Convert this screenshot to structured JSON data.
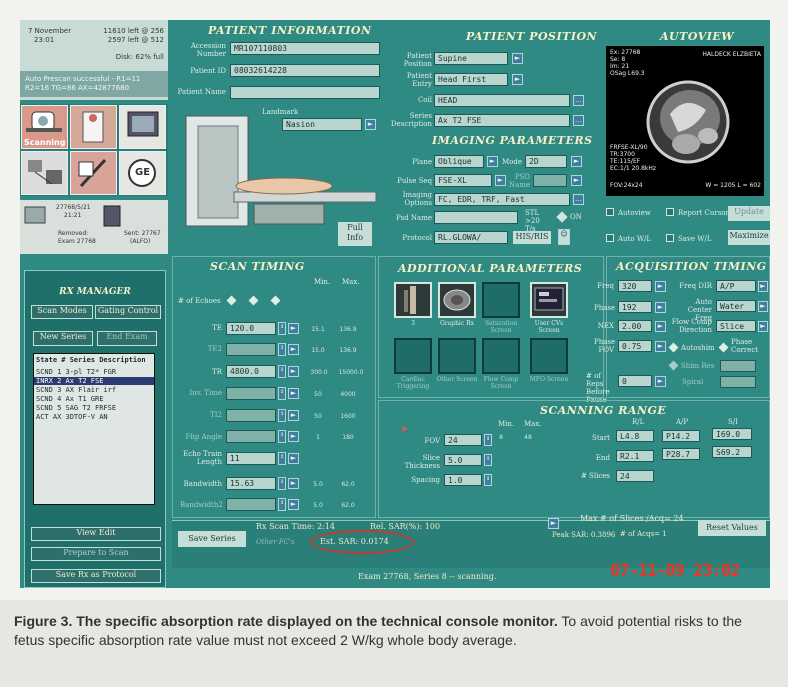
{
  "status": {
    "date": "7 November",
    "time": "23:01",
    "left1": "11610 left @ 256",
    "left2": "2597 left @ 512",
    "disk": "Disk: 62% full",
    "msg1": "Auto Prescan successful - R1=11",
    "msg2": "R2=16  TG=86  AX=42877680"
  },
  "modes": {
    "scanning_label": "Scanning",
    "ge_label": "GE",
    "info1": "27768/5/21",
    "info2": "21:21",
    "removed": "Removed:",
    "exam": "Exam 27768",
    "sent": "Sent: 27767",
    "sent2": "(ALFO)"
  },
  "patient_info": {
    "title": "PATIENT INFORMATION",
    "accession_label": "Accession Number",
    "accession_value": "MR107110803",
    "patient_id_label": "Patient ID",
    "patient_id_value": "08032614228",
    "patient_name_label": "Patient Name",
    "patient_name_value": "",
    "landmark_label": "Landmark",
    "landmark_value": "Nasion",
    "full_info": "Full Info"
  },
  "patient_position": {
    "title": "PATIENT POSITION",
    "position_label": "Patient Position",
    "position_value": "Supine",
    "entry_label": "Patient Entry",
    "entry_value": "Head First",
    "coil_label": "Coil",
    "coil_value": "HEAD",
    "series_label": "Series Description",
    "series_value": "Ax T2 FSE"
  },
  "imaging": {
    "title": "IMAGING PARAMETERS",
    "plane_label": "Plane",
    "plane_value": "Oblique",
    "mode_label": "Mode",
    "mode_value": "2D",
    "pulse_label": "Pulse Seq",
    "pulse_value": "FSE-XL",
    "psd_label": "PSD Name",
    "options_label": "Imaging Options",
    "options_value": "FC, EDR, TRF, Fast",
    "psd_name_label": "Psd Name",
    "stl_label": "STL >20 T/s",
    "stl_on": "ON",
    "protocol_label": "Protocol",
    "protocol_value": "RL.GLOWA/",
    "his_ris": "HIS/RIS"
  },
  "autoview": {
    "title": "AUTOVIEW",
    "ex": "Ex: 27768",
    "se": "Se: 8",
    "im": "Im: 21",
    "osag": "OSag L69.3",
    "patient": "HALDECK ELZBIETA",
    "p1": "FRFSE-XL/90",
    "p2": "TR:3700",
    "p3": "TE:115/EF",
    "p4": "EC:1/1 20.8kHz",
    "fov": "FOV:24x24",
    "wl": "W = 1205 L = 602",
    "autoview_cb": "Autoview",
    "report_cursor_cb": "Report Cursor",
    "update": "Update",
    "auto_wl": "Auto W/L",
    "save_wl": "Save W/L",
    "maximize": "Maximize"
  },
  "rx_manager": {
    "title": "RX MANAGER",
    "scan_modes": "Scan Modes",
    "gating": "Gating Control",
    "new_series": "New Series",
    "end_exam": "End Exam",
    "col_header": "State  #  Series Description",
    "rows": [
      "SCND 1   3-pl T2* FGR",
      "INRX 2   Ax T2 FSE",
      "SCND 3   AX Flair irf",
      "SCND 4   Ax T1 GRE",
      "SCND 5   SAG T2 FRFSE",
      "ACT      AX 3DTOF-V AN"
    ],
    "view_edit": "View Edit",
    "prepare": "Prepare to Scan",
    "save_rx": "Save Rx as Protocol"
  },
  "scan_timing": {
    "title": "SCAN TIMING",
    "min": "Min.",
    "max": "Max.",
    "echoes_label": "# of Echoes",
    "te_label": "TE",
    "te_value": "120.0",
    "te2_label": "TE2",
    "tr_label": "TR",
    "tr_value": "4800.0",
    "inv_label": "Inv. Time",
    "ti2_label": "TI2",
    "flip_label": "Flip Angle",
    "etl_label": "Echo Train Length",
    "etl_value": "11",
    "bw_label": "Bandwidth",
    "bw_value": "15.63",
    "bw2_label": "Bandwidth2",
    "te_min": "15.1",
    "te_max": "136.9",
    "te2_min": "15.0",
    "te2_max": "136.9",
    "tr_min": "300.0",
    "tr_max": "15000.0",
    "inv_min": "50",
    "inv_max": "4000",
    "ti2_min": "50",
    "ti2_max": "1600",
    "flip_min": "1",
    "flip_max": "180",
    "bw_min": "5.0",
    "bw_max": "62.0",
    "bw2_min": "5.0",
    "bw2_max": "62.0"
  },
  "additional": {
    "title": "ADDITIONAL PARAMETERS",
    "t1": "3",
    "t2": "Graphic Rx",
    "t3": "Saturation Screen",
    "t4": "User CVs Screen",
    "t5": "Cardiac Triggering",
    "t6": "Other Screen",
    "t7": "Flow Comp Screen",
    "t8": "MFO Screen"
  },
  "acquisition": {
    "title": "ACQUISITION TIMING",
    "freq_label": "Freq",
    "freq_value": "320",
    "phase_label": "Phase",
    "phase_value": "192",
    "nex_label": "NEX",
    "nex_value": "2.00",
    "phase_fov_label": "Phase FOV",
    "phase_fov_value": "0.75",
    "freq_dir_label": "Freq DIR",
    "freq_dir_value": "A/P",
    "auto_center_label": "Auto Center Freq",
    "auto_center_value": "Water",
    "flow_comp_label": "Flow Comp Direction",
    "flow_comp_value": "Slice",
    "autoshim": "Autoshim",
    "phase_correct": "Phase Correct",
    "shim": "Shim Res",
    "spiral": "Spiral",
    "reps_label": "# of Reps Before Pause",
    "reps_value": "0"
  },
  "scanning_range": {
    "title": "SCANNING RANGE",
    "min": "Min.",
    "max": "Max.",
    "fov_label": "FOV",
    "fov_value": "24",
    "slice_label": "Slice Thickness",
    "slice_value": "5.0",
    "spacing_label": "Spacing",
    "spacing_value": "1.0",
    "fov_min": "8",
    "fov_max": "48",
    "rl": "R/L",
    "ap": "A/P",
    "si": "S/I",
    "start_label": "Start",
    "end_label": "End",
    "start_rl": "L4.8",
    "start_ap": "P14.2",
    "start_si": "I69.0",
    "end_rl": "R2.1",
    "end_ap": "P28.7",
    "end_si": "S69.2",
    "slices_label": "# Slices",
    "slices_value": "24"
  },
  "bottom": {
    "save_series": "Save Series",
    "rx_time": "Rx Scan Time: 2:14",
    "other_fcs": "Other FC's",
    "rel_sar": "Rel. SAR(%): 100",
    "est_sar": "Est. SAR: 0.0174",
    "max_slices": "Max # of Slices /Acq= 24",
    "peak_sar": "Peak SAR: 0.3896",
    "acqs": "# of Acqs= 1",
    "reset": "Reset Values",
    "exam_status": "Exam 27768, Series 8 -- scanning.",
    "timestamp": "07-11-09 23:02"
  },
  "caption": {
    "bold": "Figure 3. The specific absorption rate displayed on the technical console monitor.",
    "text": " To avoid potential risks to the fetus specific absorption rate value must not exceed 2 W/kg whole body average."
  },
  "colors": {
    "panel": "#2f8a83",
    "sar_circle": "#c63a2e",
    "timestamp": "#e23a2a"
  }
}
